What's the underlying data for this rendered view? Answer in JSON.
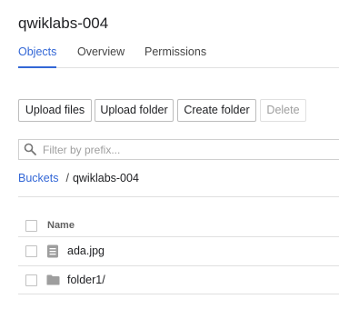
{
  "bucket": {
    "title": "qwiklabs-004"
  },
  "tabs": [
    {
      "label": "Objects",
      "active": true
    },
    {
      "label": "Overview",
      "active": false
    },
    {
      "label": "Permissions",
      "active": false
    }
  ],
  "toolbar": {
    "upload_files": "Upload files",
    "upload_folder": "Upload folder",
    "create_folder": "Create folder",
    "delete": "Delete"
  },
  "filter": {
    "placeholder": "Filter by prefix...",
    "value": ""
  },
  "breadcrumb": {
    "root": "Buckets",
    "separator": "/",
    "current": "qwiklabs-004"
  },
  "table": {
    "columns": [
      "Name"
    ],
    "rows": [
      {
        "name": "ada.jpg",
        "icon": "file-icon"
      },
      {
        "name": "folder1/",
        "icon": "folder-icon"
      }
    ]
  },
  "colors": {
    "accent": "#3367d6",
    "icon_gray": "#9e9e9e"
  }
}
